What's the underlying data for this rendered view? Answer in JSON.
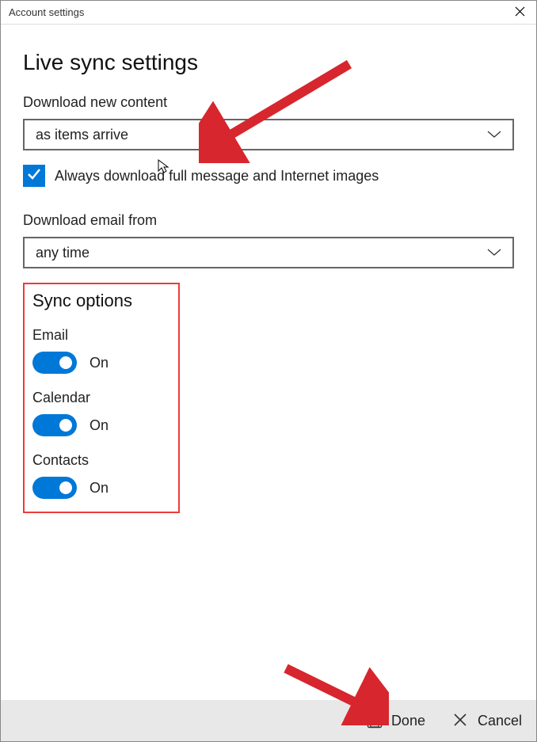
{
  "titlebar": {
    "title": "Account settings"
  },
  "main": {
    "heading": "Live sync settings",
    "download_content_label": "Download new content",
    "download_content_value": "as items arrive",
    "always_download_label": "Always download full message and Internet images",
    "download_email_label": "Download email from",
    "download_email_value": "any time"
  },
  "sync": {
    "heading": "Sync options",
    "items": [
      {
        "label": "Email",
        "state": "On"
      },
      {
        "label": "Calendar",
        "state": "On"
      },
      {
        "label": "Contacts",
        "state": "On"
      }
    ]
  },
  "footer": {
    "done_label": "Done",
    "cancel_label": "Cancel"
  }
}
